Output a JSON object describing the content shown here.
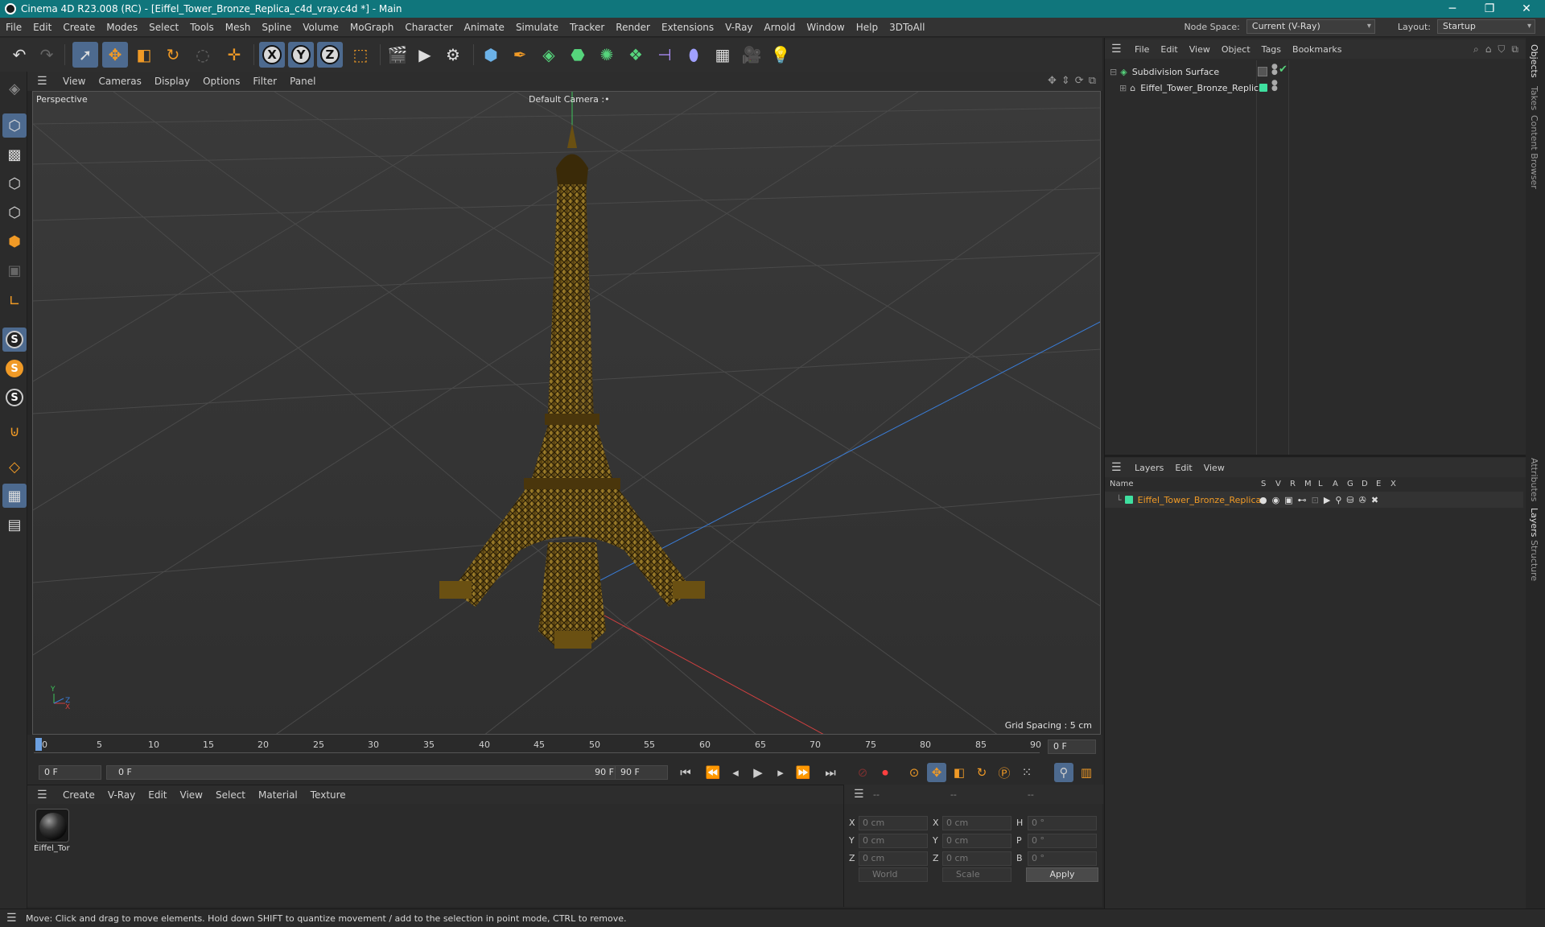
{
  "window": {
    "title": "Cinema 4D R23.008 (RC) - [Eiffel_Tower_Bronze_Replica_c4d_vray.c4d *] - Main",
    "minimize": "─",
    "maximize": "❐",
    "close": "✕"
  },
  "menubar": {
    "items": [
      "File",
      "Edit",
      "Create",
      "Modes",
      "Select",
      "Tools",
      "Mesh",
      "Spline",
      "Volume",
      "MoGraph",
      "Character",
      "Animate",
      "Simulate",
      "Tracker",
      "Render",
      "Extensions",
      "V-Ray",
      "Arnold",
      "Window",
      "Help",
      "3DToAll"
    ],
    "node_space_label": "Node Space:",
    "node_space_value": "Current (V-Ray)",
    "layout_label": "Layout:",
    "layout_value": "Startup"
  },
  "axis_buttons": {
    "x": "X",
    "y": "Y",
    "z": "Z"
  },
  "viewport": {
    "menu": [
      "View",
      "Cameras",
      "Display",
      "Options",
      "Filter",
      "Panel"
    ],
    "view_name": "Perspective",
    "camera": "Default Camera",
    "camera_suffix": ":•",
    "grid_spacing": "Grid Spacing : 5 cm",
    "axis_labels": {
      "y": "Y",
      "z": "Z",
      "x": "X"
    }
  },
  "timeline": {
    "ticks": [
      "0",
      "5",
      "10",
      "15",
      "20",
      "25",
      "30",
      "35",
      "40",
      "45",
      "50",
      "55",
      "60",
      "65",
      "70",
      "75",
      "80",
      "85",
      "90"
    ],
    "current_frame": "0 F",
    "start_frame": "0 F",
    "range_start": "0 F",
    "range_end": "90 F",
    "end_frame": "90 F"
  },
  "material_manager": {
    "menu": [
      "Create",
      "V-Ray",
      "Edit",
      "View",
      "Select",
      "Material",
      "Texture"
    ],
    "materials": [
      {
        "name": "Eiffel_Tor"
      }
    ]
  },
  "coordinates": {
    "headers": [
      "--",
      "--",
      "--"
    ],
    "rows": [
      {
        "l1": "X",
        "v1": "0 cm",
        "l2": "X",
        "v2": "0 cm",
        "l3": "H",
        "v3": "0 °"
      },
      {
        "l1": "Y",
        "v1": "0 cm",
        "l2": "Y",
        "v2": "0 cm",
        "l3": "P",
        "v3": "0 °"
      },
      {
        "l1": "Z",
        "v1": "0 cm",
        "l2": "Z",
        "v2": "0 cm",
        "l3": "B",
        "v3": "0 °"
      }
    ],
    "coord_system": "World",
    "mode": "Scale",
    "apply": "Apply"
  },
  "object_manager": {
    "menu": [
      "File",
      "Edit",
      "View",
      "Object",
      "Tags",
      "Bookmarks"
    ],
    "objects": [
      {
        "name": "Subdivision Surface"
      },
      {
        "name": "Eiffel_Tower_Bronze_Replica"
      }
    ]
  },
  "layer_manager": {
    "menu": [
      "Layers",
      "Edit",
      "View"
    ],
    "columns": [
      "Name",
      "S",
      "V",
      "R",
      "M",
      "L",
      "A",
      "G",
      "D",
      "E",
      "X"
    ],
    "layers": [
      {
        "name": "Eiffel_Tower_Bronze_Replica",
        "color": "#3fe0a0"
      }
    ]
  },
  "side_tabs": [
    "Objects",
    "Takes",
    "Content Browser",
    "Attributes",
    "Layers",
    "Structure"
  ],
  "status": {
    "message": "Move: Click and drag to move elements. Hold down SHIFT to quantize movement / add to the selection in point mode, CTRL to remove."
  },
  "colors": {
    "titlebar": "#10767c",
    "accent_highlight": "#4d6a8f",
    "layer_name": "#f09a26",
    "tower_bronze": "#8a6a1e"
  }
}
